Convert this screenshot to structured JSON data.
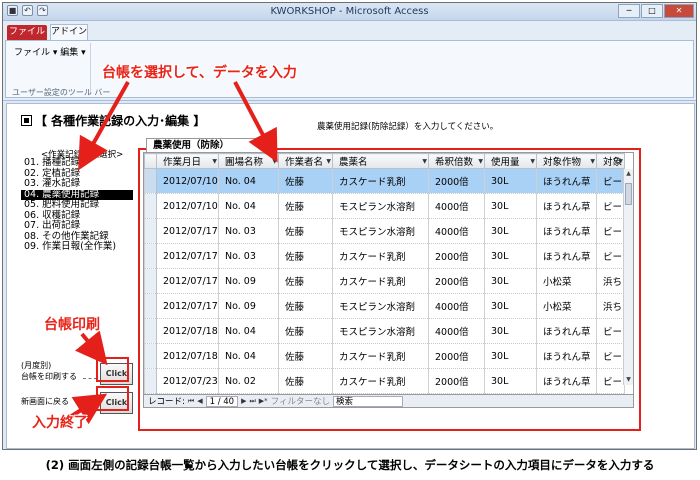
{
  "window": {
    "title": "KWORKSHOP - Microsoft Access",
    "min": "─",
    "max": "□",
    "close": "✕"
  },
  "quick_access": [
    "■",
    "↶",
    "↷"
  ],
  "ribbon": {
    "tab_file": "ファイル",
    "tab_addin": "アドイン",
    "menu_file": "ファイル ▾",
    "menu_edit": "編集 ▾",
    "group_label": "ユーザー設定のツール バー"
  },
  "form": {
    "title": "【 各種作業記録の入力･編集 】",
    "hint": "農薬使用記録(防除記録）を入力してください。",
    "ledger_caption": "<作業記録台帳選択>",
    "ledgers": [
      "01. 播種記録",
      "02. 定植記録",
      "03. 灌水記録",
      "04. 農薬使用記録",
      "05. 肥料使用記録",
      "06. 収穫記録",
      "07. 出荷記録",
      "08. その他作業記録",
      "09. 作業日報(全作業)"
    ],
    "selected_ledger": 3,
    "print_caption_1": "(月度別)",
    "print_caption_2": "台帳を印刷する",
    "back_caption": "新画面に戻る",
    "click_label": "Click"
  },
  "datasheet": {
    "tab": "農薬使用（防除）",
    "columns": [
      "作業月日",
      "圃場名称",
      "作業者名",
      "農薬名",
      "希釈倍数",
      "使用量",
      "対象作物",
      "対象"
    ],
    "rows": [
      [
        "2012/07/10",
        "No. 04",
        "佐藤",
        "カスケード乳剤",
        "2000倍",
        "30L",
        "ほうれん草",
        "ビーナ"
      ],
      [
        "2012/07/10",
        "No. 04",
        "佐藤",
        "モスピラン水溶剤",
        "4000倍",
        "30L",
        "ほうれん草",
        "ビーナ"
      ],
      [
        "2012/07/17",
        "No. 03",
        "佐藤",
        "モスピラン水溶剤",
        "4000倍",
        "30L",
        "ほうれん草",
        "ビーナ"
      ],
      [
        "2012/07/17",
        "No. 03",
        "佐藤",
        "カスケード乳剤",
        "2000倍",
        "30L",
        "ほうれん草",
        "ビーナ"
      ],
      [
        "2012/07/17",
        "No. 09",
        "佐藤",
        "カスケード乳剤",
        "2000倍",
        "30L",
        "小松菜",
        "浜ちゃ"
      ],
      [
        "2012/07/17",
        "No. 09",
        "佐藤",
        "モスピラン水溶剤",
        "4000倍",
        "30L",
        "小松菜",
        "浜ちゃ"
      ],
      [
        "2012/07/18",
        "No. 04",
        "佐藤",
        "モスピラン水溶剤",
        "4000倍",
        "30L",
        "ほうれん草",
        "ビーナ"
      ],
      [
        "2012/07/18",
        "No. 04",
        "佐藤",
        "カスケード乳剤",
        "2000倍",
        "30L",
        "ほうれん草",
        "ビーナ"
      ],
      [
        "2012/07/23",
        "No. 02",
        "佐藤",
        "カスケード乳剤",
        "2000倍",
        "30L",
        "ほうれん草",
        "ビーナ"
      ]
    ],
    "active_row": 0,
    "nav": {
      "label": "レコード:",
      "first": "⏮",
      "prev": "◀",
      "current": "1 / 40",
      "next": "▶",
      "last": "⏭",
      "new": "▶*",
      "filter": "フィルターなし",
      "search": "検索"
    }
  },
  "annotations": {
    "top": "台帳を選択して、データを入力",
    "print": "台帳印刷",
    "finish": "入力終了"
  },
  "caption": "(2) 画面左側の記録台帳一覧から入力したい台帳をクリックして選択し、データシートの入力項目にデータを入力する",
  "colors": {
    "annotation_red": "#e5201a",
    "active_row": "#a9d0f5",
    "file_tab": "#c0272d"
  }
}
